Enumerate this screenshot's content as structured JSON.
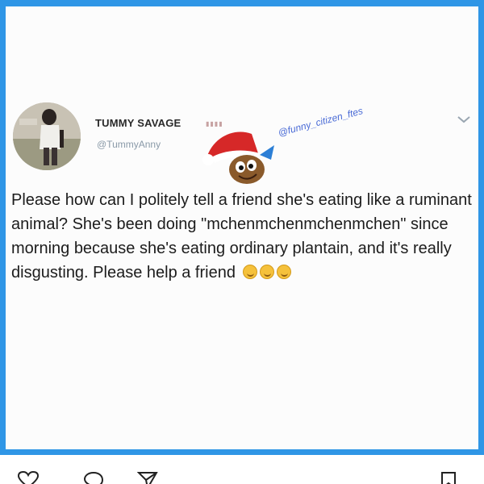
{
  "post": {
    "display_name": "TUMMY SAVAGE",
    "handle": "@TummyAnny",
    "watermark": "@funny_citizen_ftes",
    "body": "Please how can I politely tell a friend she's eating like a ruminant animal? She's been doing \"mchenmchenmchenmchen\" since morning because she's eating ordinary plantain, and it's really disgusting. Please help a friend",
    "emoji_count": 3
  },
  "icons": {
    "menu": "chevron-down-icon",
    "like": "heart-icon",
    "comment": "comment-icon",
    "share": "paper-plane-icon",
    "save": "bookmark-icon"
  },
  "colors": {
    "frame_border": "#2f96e6",
    "handle": "#8a9aa8",
    "text": "#1c1c1c"
  }
}
